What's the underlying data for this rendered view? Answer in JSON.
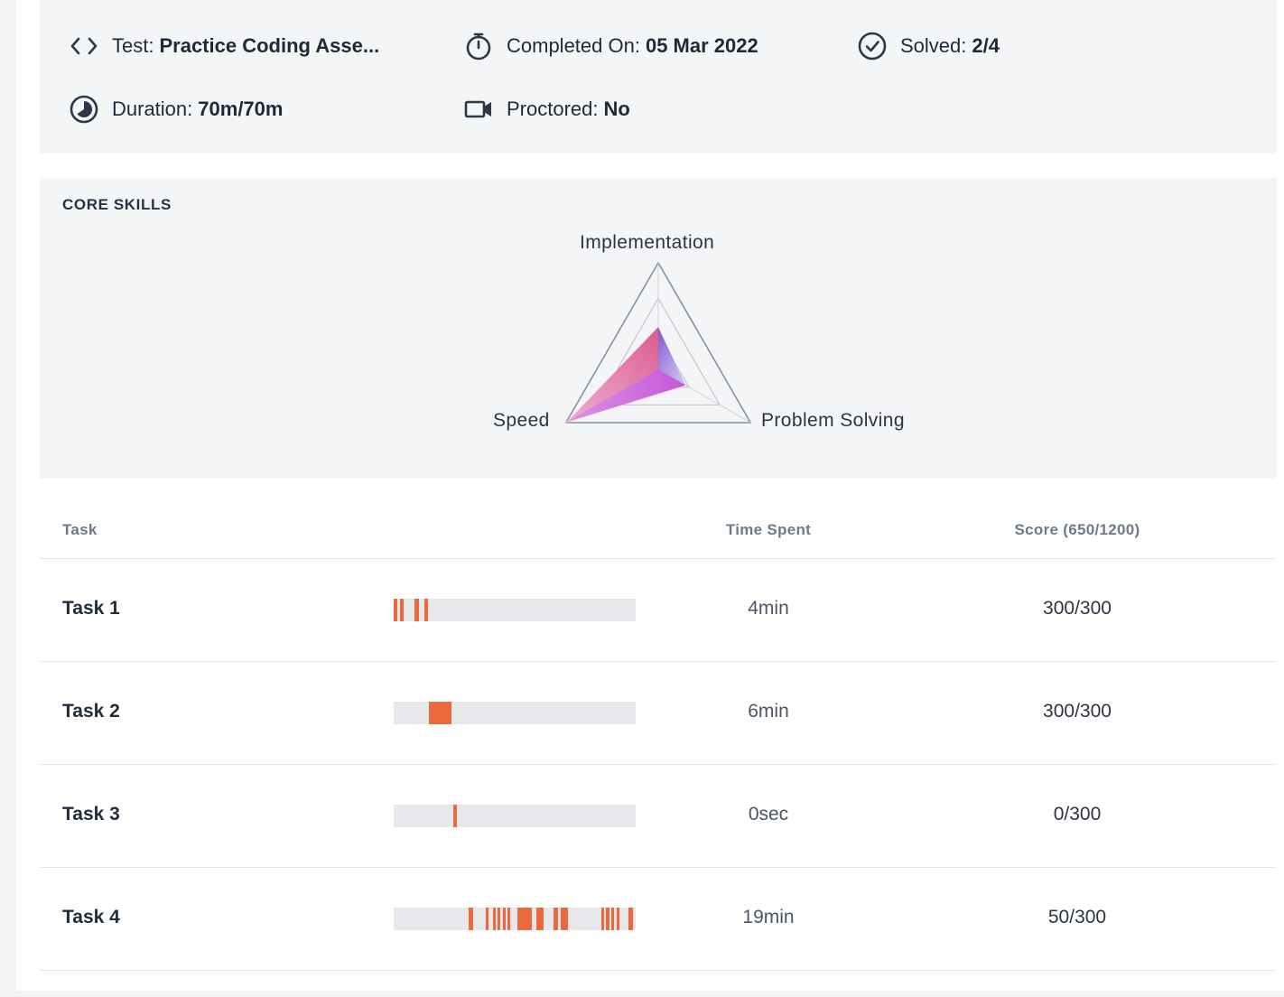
{
  "summary": {
    "test_label": "Test:",
    "test_value": "Practice Coding Asse...",
    "completed_label": "Completed On:",
    "completed_value": "05 Mar 2022",
    "solved_label": "Solved:",
    "solved_value": "2/4",
    "duration_label": "Duration:",
    "duration_value": "70m/70m",
    "proctored_label": "Proctored:",
    "proctored_value": "No"
  },
  "core_skills": {
    "title": "CORE SKILLS",
    "chart_data": {
      "type": "radar",
      "axes": [
        "Implementation",
        "Speed",
        "Problem Solving"
      ],
      "series": [
        {
          "values": [
            0.4,
            0.55,
            0.3
          ]
        },
        {
          "values": [
            0.4,
            1.0,
            0.3
          ]
        }
      ],
      "range": [
        0,
        1
      ],
      "rings": 3,
      "colors": [
        "#7b4fd0",
        "#d7568a",
        "#c24fd6"
      ]
    }
  },
  "tasks_table": {
    "headers": {
      "task": "Task",
      "time": "Time Spent",
      "score": "Score (650/1200)"
    },
    "rows": [
      {
        "name": "Task 1",
        "time": "4min",
        "score": "300/300",
        "activity": [
          [
            0.0,
            0.015
          ],
          [
            0.025,
            0.04
          ],
          [
            0.085,
            0.105
          ],
          [
            0.125,
            0.14
          ]
        ]
      },
      {
        "name": "Task 2",
        "time": "6min",
        "score": "300/300",
        "activity": [
          [
            0.145,
            0.24
          ]
        ]
      },
      {
        "name": "Task 3",
        "time": "0sec",
        "score": "0/300",
        "activity": [
          [
            0.245,
            0.262
          ]
        ]
      },
      {
        "name": "Task 4",
        "time": "19min",
        "score": "50/300",
        "activity": [
          [
            0.31,
            0.33
          ],
          [
            0.38,
            0.39
          ],
          [
            0.41,
            0.42
          ],
          [
            0.43,
            0.44
          ],
          [
            0.45,
            0.46
          ],
          [
            0.47,
            0.48
          ],
          [
            0.51,
            0.57
          ],
          [
            0.59,
            0.62
          ],
          [
            0.66,
            0.68
          ],
          [
            0.69,
            0.72
          ],
          [
            0.86,
            0.87
          ],
          [
            0.875,
            0.89
          ],
          [
            0.9,
            0.91
          ],
          [
            0.92,
            0.93
          ],
          [
            0.97,
            0.99
          ]
        ]
      }
    ]
  }
}
